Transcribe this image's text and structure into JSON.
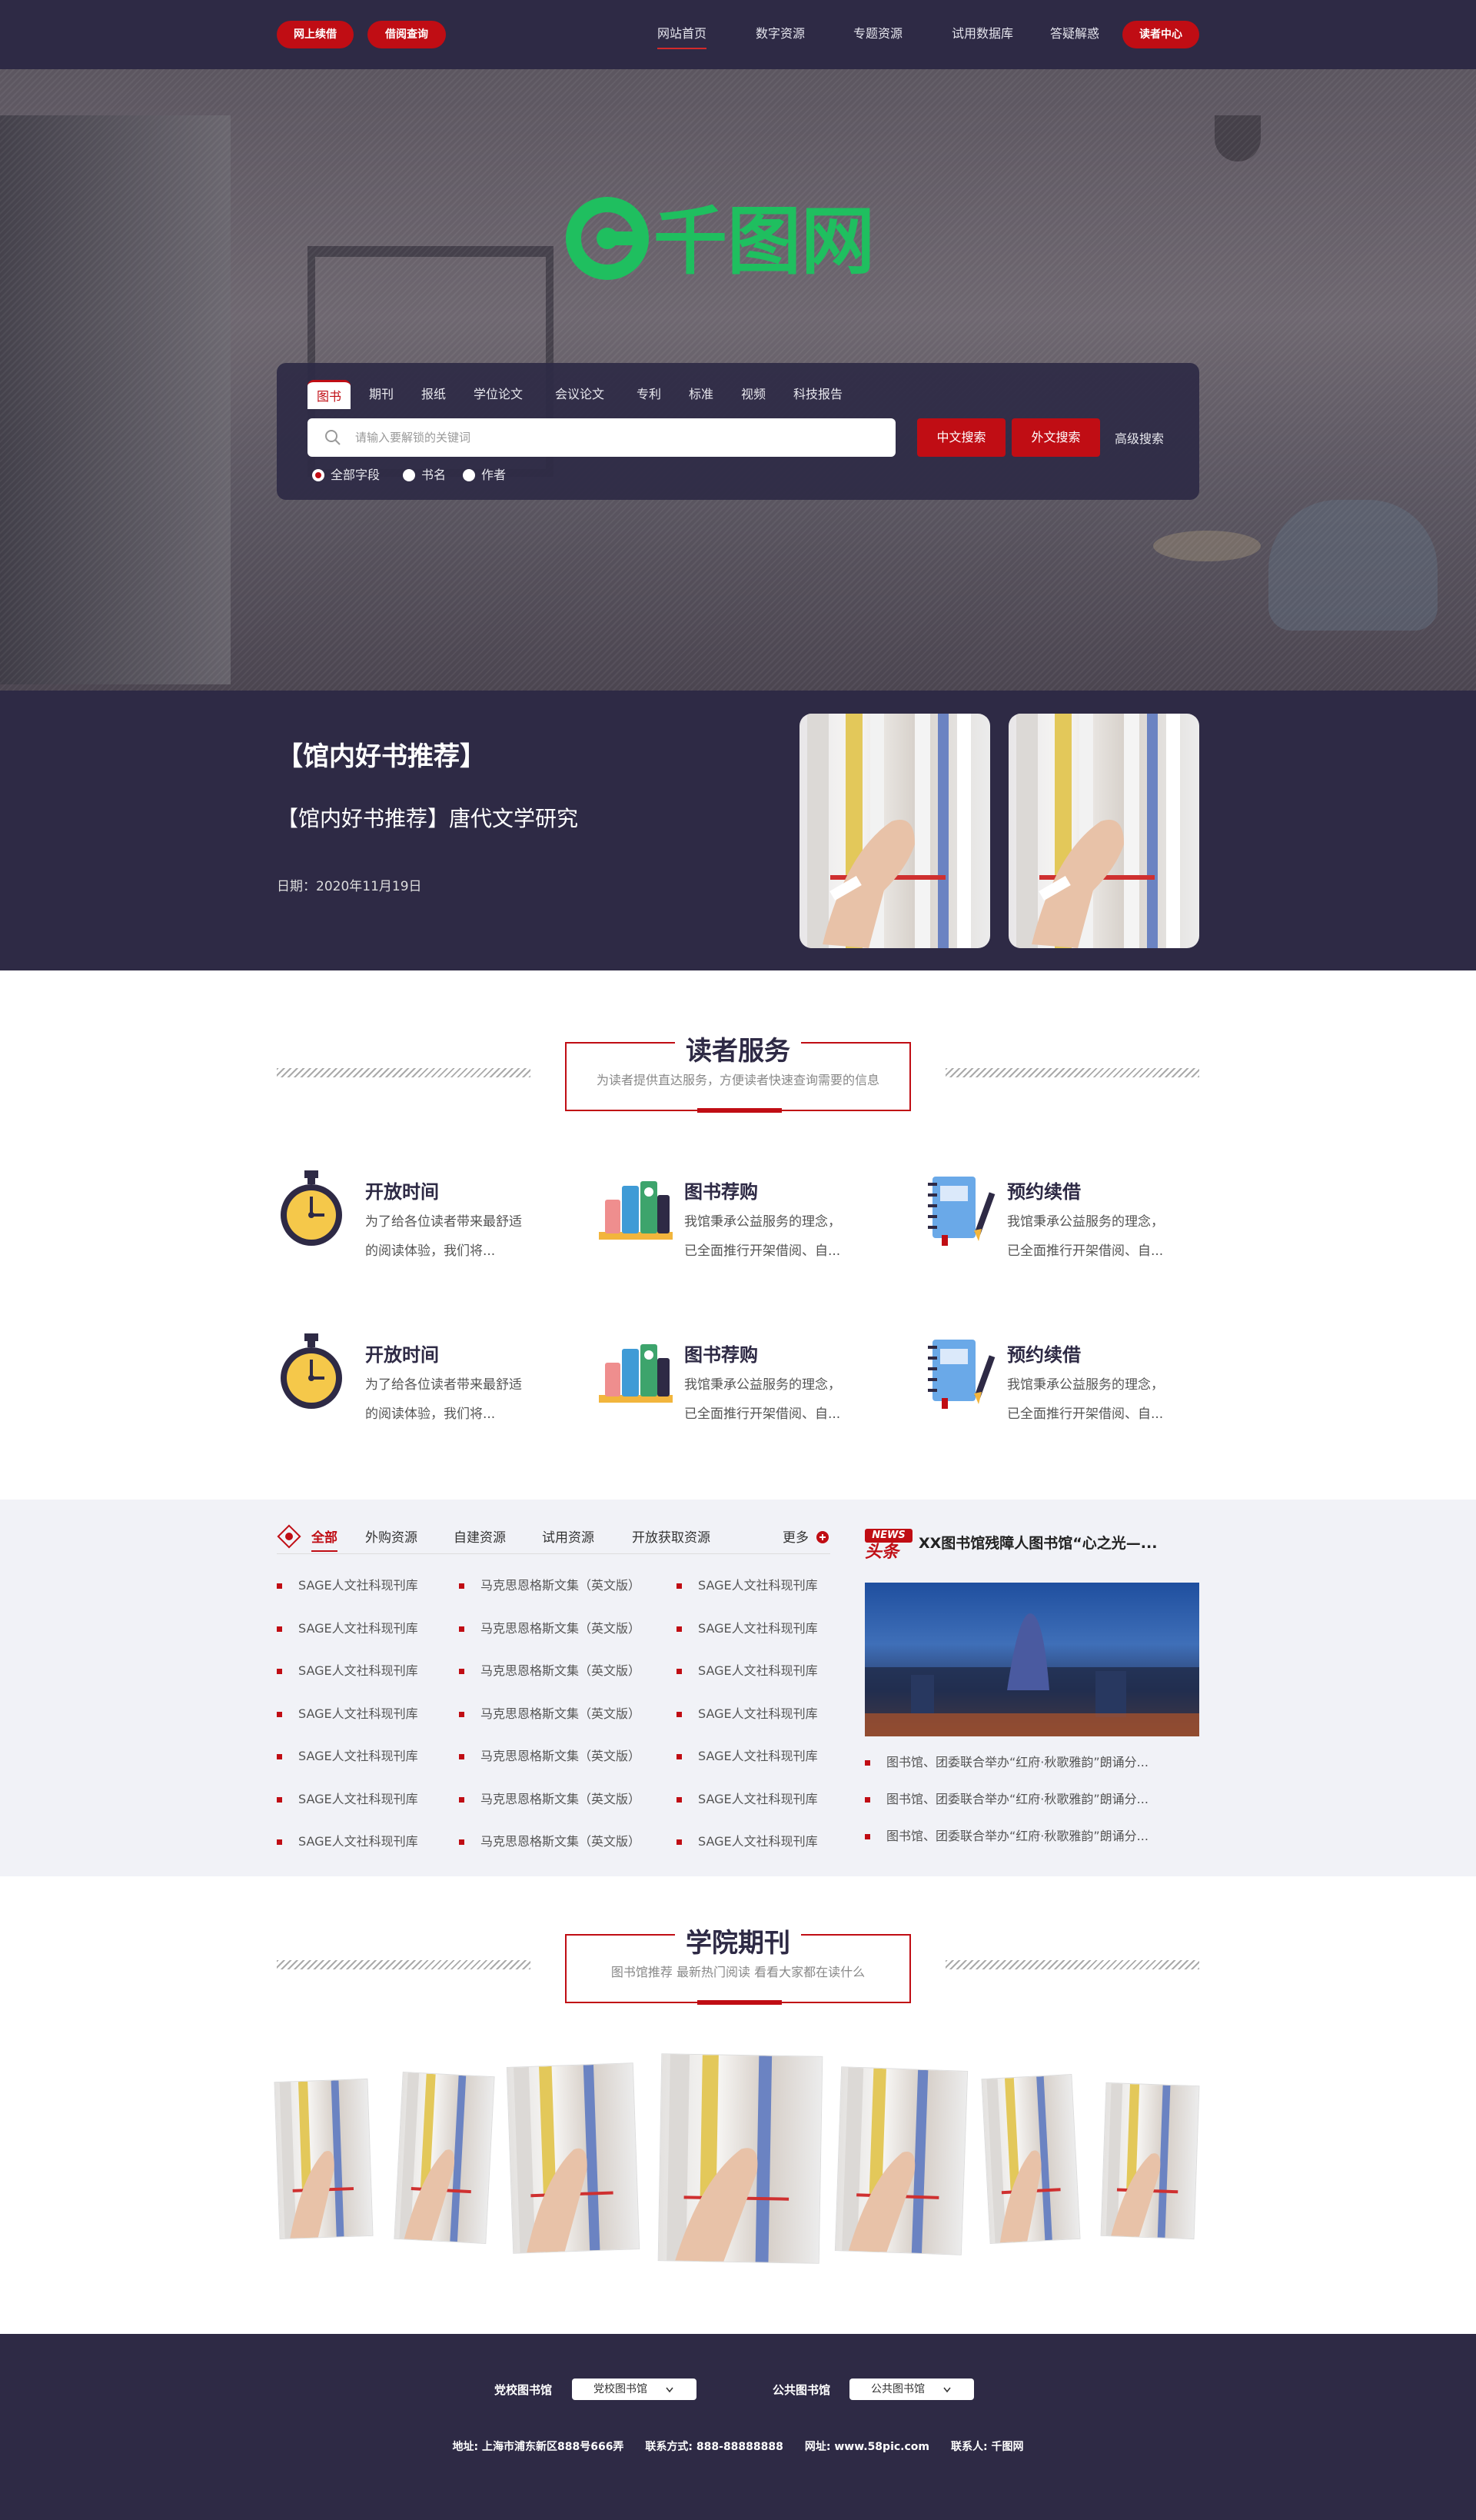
{
  "header": {
    "left_buttons": [
      "网上续借",
      "借阅查询"
    ],
    "nav": [
      "网站首页",
      "数字资源",
      "专题资源",
      "试用数据库",
      "答疑解惑"
    ],
    "reader_center": "读者中心"
  },
  "hero": {
    "logo_text": "千图网",
    "search": {
      "tabs": [
        "图书",
        "期刊",
        "报纸",
        "学位论文",
        "会议论文",
        "专利",
        "标准",
        "视频",
        "科技报告"
      ],
      "placeholder": "请输入要解锁的关键词",
      "cn_button": "中文搜索",
      "foreign_button": "外文搜索",
      "advanced": "高级搜索",
      "radios": [
        "全部字段",
        "书名",
        "作者"
      ]
    }
  },
  "recommend": {
    "title": "【馆内好书推荐】",
    "subtitle": "【馆内好书推荐】唐代文学研究",
    "date": "日期：2020年11月19日"
  },
  "reader_service": {
    "title": "读者服务",
    "desc": "为读者提供直达服务，方便读者快速查询需要的信息",
    "items": [
      {
        "icon": "stopwatch-icon",
        "title": "开放时间",
        "lines": [
          "为了给各位读者带来最舒适",
          "的阅读体验，我们将..."
        ]
      },
      {
        "icon": "books-icon",
        "title": "图书荐购",
        "lines": [
          "我馆秉承公益服务的理念，",
          "已全面推行开架借阅、自..."
        ]
      },
      {
        "icon": "notebook-icon",
        "title": "预约续借",
        "lines": [
          "我馆秉承公益服务的理念，",
          "已全面推行开架借阅、自..."
        ]
      },
      {
        "icon": "stopwatch-icon",
        "title": "开放时间",
        "lines": [
          "为了给各位读者带来最舒适",
          "的阅读体验，我们将..."
        ]
      },
      {
        "icon": "books-icon",
        "title": "图书荐购",
        "lines": [
          "我馆秉承公益服务的理念，",
          "已全面推行开架借阅、自..."
        ]
      },
      {
        "icon": "notebook-icon",
        "title": "预约续借",
        "lines": [
          "我馆秉承公益服务的理念，",
          "已全面推行开架借阅、自..."
        ]
      }
    ]
  },
  "resources": {
    "tabs": [
      "全部",
      "外购资源",
      "自建资源",
      "试用资源",
      "开放获取资源"
    ],
    "more": "更多",
    "col1": [
      "SAGE人文社科现刊库",
      "SAGE人文社科现刊库",
      "SAGE人文社科现刊库",
      "SAGE人文社科现刊库",
      "SAGE人文社科现刊库",
      "SAGE人文社科现刊库",
      "SAGE人文社科现刊库"
    ],
    "col2": [
      "马克思恩格斯文集（英文版）",
      "马克思恩格斯文集（英文版）",
      "马克思恩格斯文集（英文版）",
      "马克思恩格斯文集（英文版）",
      "马克思恩格斯文集（英文版）",
      "马克思恩格斯文集（英文版）",
      "马克思恩格斯文集（英文版）"
    ],
    "col3": [
      "SAGE人文社科现刊库",
      "SAGE人文社科现刊库",
      "SAGE人文社科现刊库",
      "SAGE人文社科现刊库",
      "SAGE人文社科现刊库",
      "SAGE人文社科现刊库",
      "SAGE人文社科现刊库"
    ],
    "news_badge_top": "NEWS",
    "news_badge_bottom": "头条",
    "news_headline": "XX图书馆残障人图书馆“心之光—...",
    "news_items": [
      "图书馆、团委联合举办“红府·秋歌雅韵”朗诵分...",
      "图书馆、团委联合举办“红府·秋歌雅韵”朗诵分...",
      "图书馆、团委联合举办“红府·秋歌雅韵”朗诵分..."
    ]
  },
  "journals": {
    "title": "学院期刊",
    "desc": "图书馆推荐 最新热门阅读 看看大家都在读什么"
  },
  "footer": {
    "party_label": "党校图书馆",
    "party_select": "党校图书馆",
    "public_label": "公共图书馆",
    "public_select": "公共图书馆",
    "info": "地址: 上海市浦东新区888号666弄　　联系方式: 888-88888888　　网址: www.58pic.com　　联系人: 千图网"
  },
  "colors": {
    "brand_red": "#c00d14",
    "navy": "#2e2a45",
    "logo_green": "#1fbf5f",
    "light_bg": "#f1f2f7"
  }
}
